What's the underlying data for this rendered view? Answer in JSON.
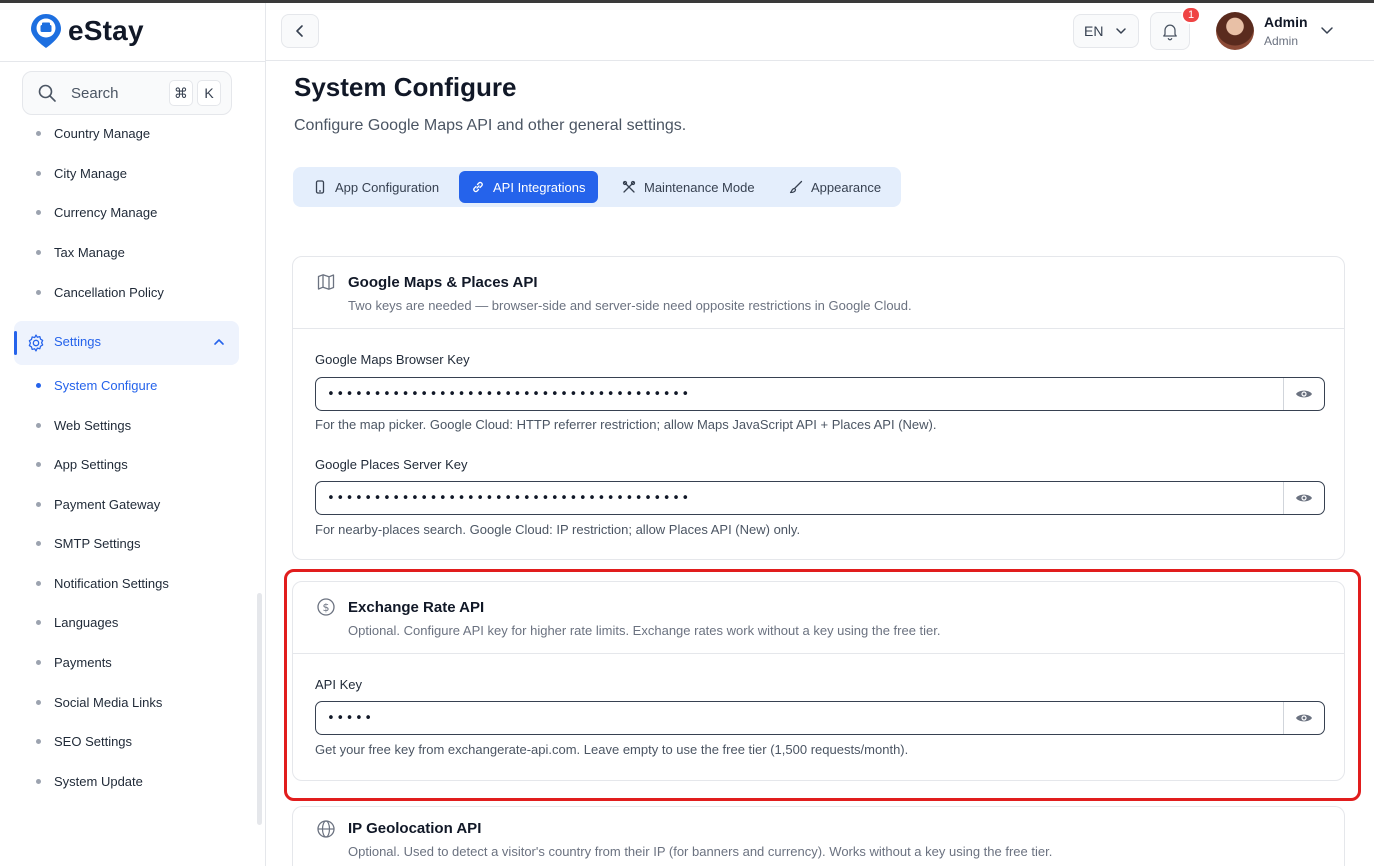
{
  "app": {
    "name": "eStay"
  },
  "search": {
    "label": "Search",
    "kbd_cmd": "⌘",
    "kbd_key": "K"
  },
  "sidebar": {
    "items_top": [
      "Country Manage",
      "City Manage",
      "Currency Manage",
      "Tax Manage",
      "Cancellation Policy"
    ],
    "group_label": "Settings",
    "items_settings": [
      "System Configure",
      "Web Settings",
      "App Settings",
      "Payment Gateway",
      "SMTP Settings",
      "Notification Settings",
      "Languages",
      "Payments",
      "Social Media Links",
      "SEO Settings",
      "System Update"
    ]
  },
  "header": {
    "language": "EN",
    "notification_count": "1",
    "user_name": "Admin",
    "user_role": "Admin"
  },
  "page": {
    "title": "System Configure",
    "subtitle": "Configure Google Maps API and other general settings."
  },
  "tabs": [
    "App Configuration",
    "API Integrations",
    "Maintenance Mode",
    "Appearance"
  ],
  "cards": {
    "maps": {
      "title": "Google Maps & Places API",
      "desc": "Two keys are needed — browser-side and server-side need opposite restrictions in Google Cloud.",
      "browser_label": "Google Maps Browser Key",
      "browser_value": "•••••••••••••••••••••••••••••••••••••••",
      "browser_help": "For the map picker. Google Cloud: HTTP referrer restriction; allow Maps JavaScript API + Places API (New).",
      "server_label": "Google Places Server Key",
      "server_value": "•••••••••••••••••••••••••••••••••••••••",
      "server_help": "For nearby-places search. Google Cloud: IP restriction; allow Places API (New) only."
    },
    "exchange": {
      "title": "Exchange Rate API",
      "desc": "Optional. Configure API key for higher rate limits. Exchange rates work without a key using the free tier.",
      "key_label": "API Key",
      "key_value": "•••••",
      "key_help": "Get your free key from exchangerate-api.com. Leave empty to use the free tier (1,500 requests/month)."
    },
    "geo": {
      "title": "IP Geolocation API",
      "desc": "Optional. Used to detect a visitor's country from their IP (for banners and currency). Works without a key using the free tier."
    }
  },
  "colors": {
    "accent": "#2563eb",
    "highlight": "#e11d1d",
    "tabs_bg": "#e4eefc"
  }
}
